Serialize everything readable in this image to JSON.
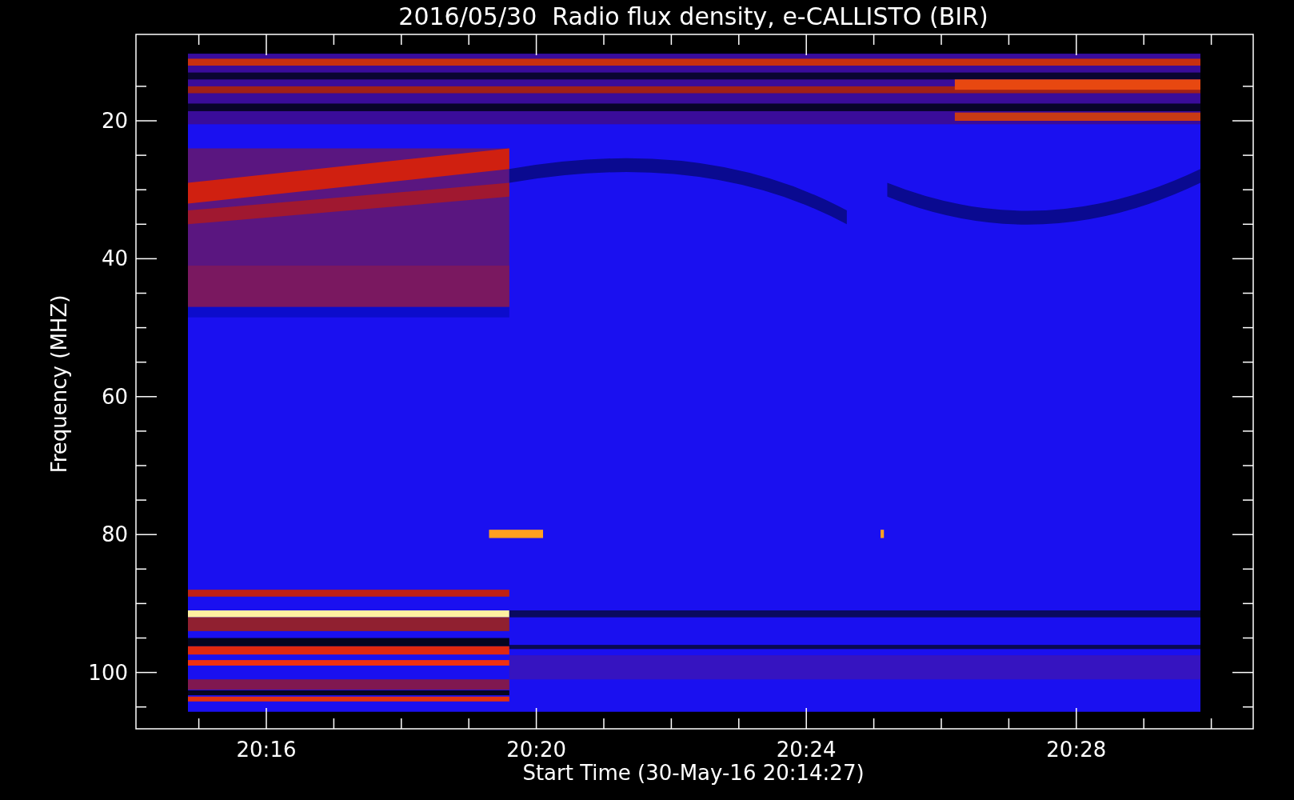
{
  "title": "2016/05/30  Radio flux density, e-CALLISTO (BIR)",
  "xlabel": "Start Time (30-May-16 20:14:27)",
  "ylabel": "Frequency (MHZ)",
  "xticks": [
    "20:16",
    "20:20",
    "20:24",
    "20:28"
  ],
  "yticks": [
    "20",
    "40",
    "60",
    "80",
    "100"
  ]
}
